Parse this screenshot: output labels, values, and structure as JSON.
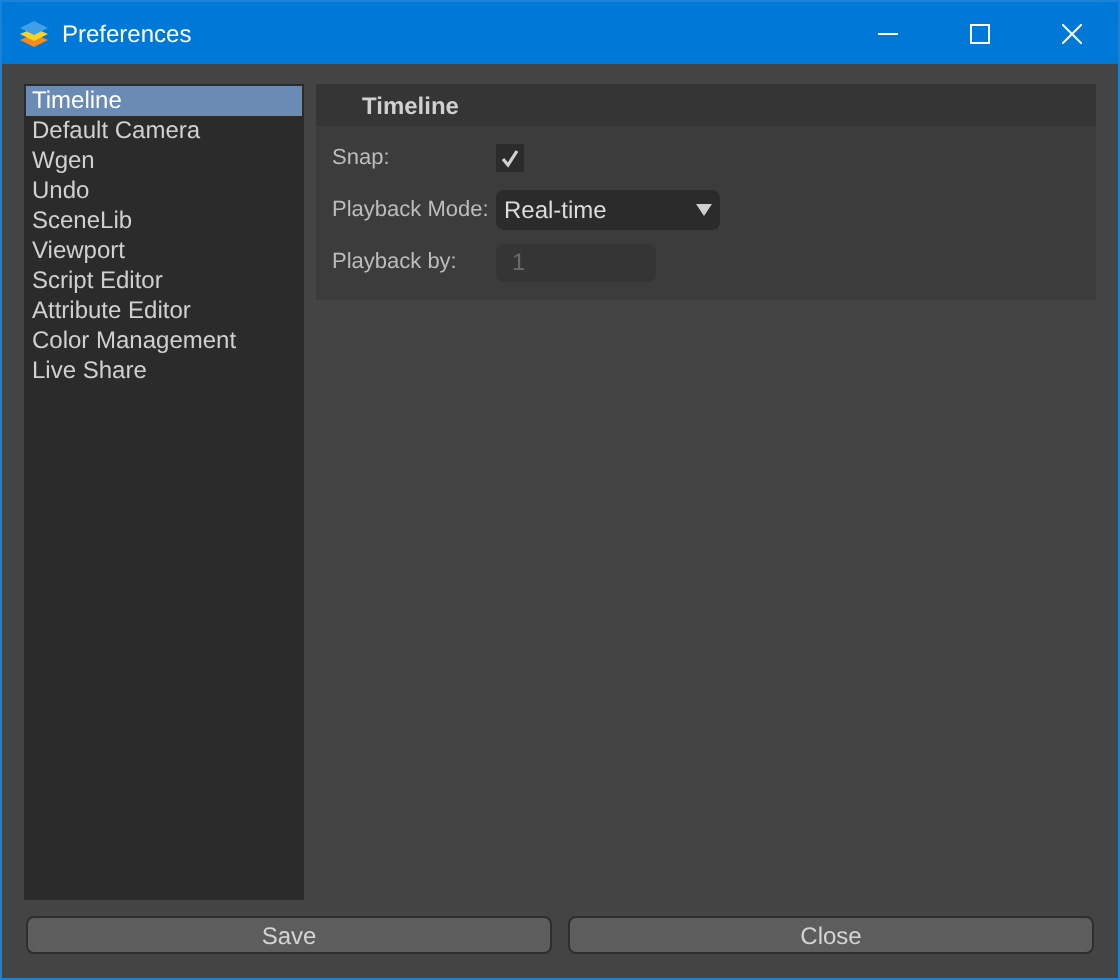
{
  "window": {
    "title": "Preferences"
  },
  "sidebar": {
    "items": [
      {
        "label": "Timeline",
        "selected": true
      },
      {
        "label": "Default Camera",
        "selected": false
      },
      {
        "label": "Wgen",
        "selected": false
      },
      {
        "label": "Undo",
        "selected": false
      },
      {
        "label": "SceneLib",
        "selected": false
      },
      {
        "label": "Viewport",
        "selected": false
      },
      {
        "label": "Script Editor",
        "selected": false
      },
      {
        "label": "Attribute Editor",
        "selected": false
      },
      {
        "label": "Color Management",
        "selected": false
      },
      {
        "label": "Live Share",
        "selected": false
      }
    ]
  },
  "section": {
    "title": "Timeline",
    "rows": [
      {
        "kind": "checkbox",
        "label": "Snap:",
        "checked": true
      },
      {
        "kind": "dropdown",
        "label": "Playback Mode:",
        "value": "Real-time"
      },
      {
        "kind": "field",
        "label": "Playback by:",
        "value": "1",
        "disabled": true
      }
    ]
  },
  "buttons": [
    "Save",
    "Close"
  ]
}
